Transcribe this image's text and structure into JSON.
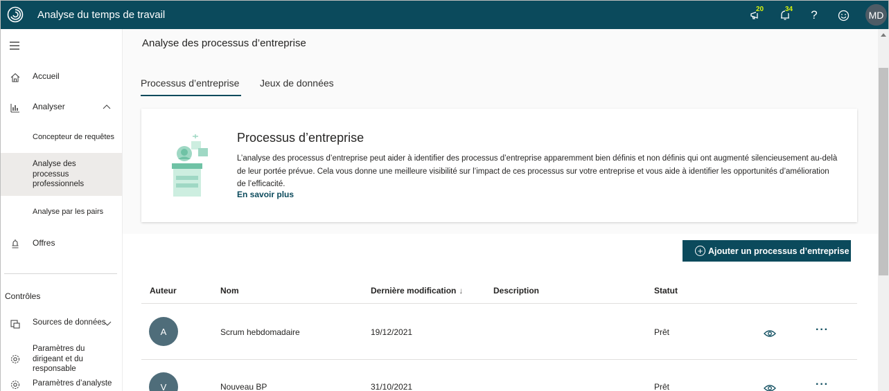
{
  "header": {
    "app_title": "Analyse du temps de travail",
    "announcements_count": "20",
    "notifications_count": "34",
    "help_label": "?",
    "user_initials": "MD"
  },
  "sidebar": {
    "items": [
      {
        "label": "Accueil",
        "icon": "home-icon"
      },
      {
        "label": "Analyser",
        "icon": "chart-icon"
      },
      {
        "label": "Offres",
        "icon": "bell-icon"
      }
    ],
    "analyser_subitems": [
      {
        "label": "Concepteur de requêtes"
      },
      {
        "label": "Analyse des processus professionnels"
      },
      {
        "label": "Analyse par les pairs"
      }
    ],
    "controls_title": "Contrôles",
    "controls_items": [
      {
        "label": "Sources de données",
        "icon": "data-sources-icon"
      },
      {
        "label": "Paramètres du dirigeant et du responsable",
        "icon": "gear-icon"
      },
      {
        "label": "Paramètres d’analyste",
        "icon": "gear-icon"
      }
    ]
  },
  "main": {
    "page_title": "Analyse des processus d’entreprise",
    "tabs": [
      {
        "label": "Processus d’entreprise",
        "selected": true
      },
      {
        "label": "Jeux de données",
        "selected": false
      }
    ],
    "card": {
      "title": "Processus d’entreprise",
      "description": "L’analyse des processus d’entreprise peut aider à identifier des processus d’entreprise apparemment bien définis et non définis qui ont augmenté silencieusement au-delà de leur portée prévue. Cela vous donne une meilleure visibilité sur l’impact de ces processus sur votre entreprise et vous aide à identifier les opportunités d’amélioration de l’efficacité.",
      "link": "En savoir plus"
    },
    "add_button": "Ajouter un processus d’entreprise",
    "table": {
      "columns": [
        "Auteur",
        "Nom",
        "Dernière modification",
        "Description",
        "Statut"
      ],
      "sort_indicator": "↓",
      "rows": [
        {
          "author_initial": "A",
          "name": "Scrum hebdomadaire",
          "modified": "19/12/2021",
          "description": "",
          "status": "Prêt"
        },
        {
          "author_initial": "V",
          "name": "Nouveau BP",
          "modified": "31/10/2021",
          "description": "",
          "status": "Prêt"
        }
      ],
      "more_label": "···"
    }
  },
  "colors": {
    "brand": "#0b4a5c",
    "badge": "#d5f20f",
    "selected_nav": "#edebe9",
    "avatar": "#4f6d7a"
  }
}
